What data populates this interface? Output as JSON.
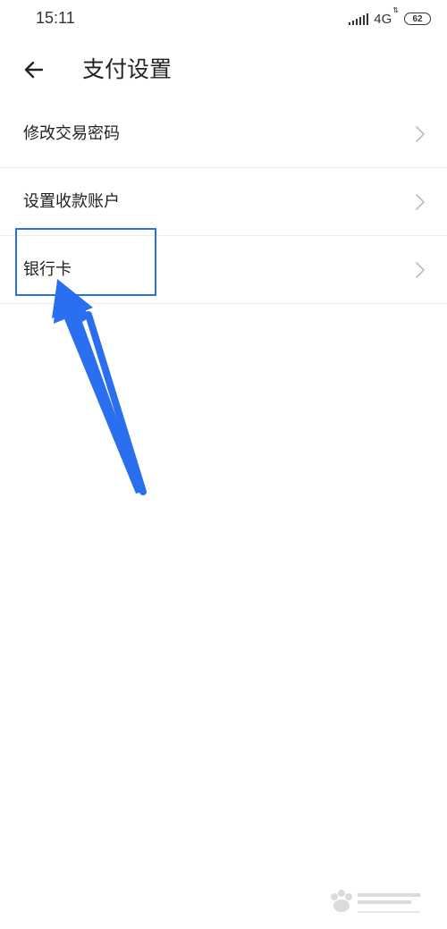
{
  "status_bar": {
    "time": "15:11",
    "network": "4G",
    "battery": "62"
  },
  "header": {
    "title": "支付设置"
  },
  "settings_list": {
    "items": [
      {
        "label": "修改交易密码"
      },
      {
        "label": "设置收款账户"
      },
      {
        "label": "银行卡"
      }
    ]
  },
  "colors": {
    "annotation_blue": "#2a6ff0",
    "chevron": "#bbbbbb",
    "divider": "#eeeeee"
  }
}
